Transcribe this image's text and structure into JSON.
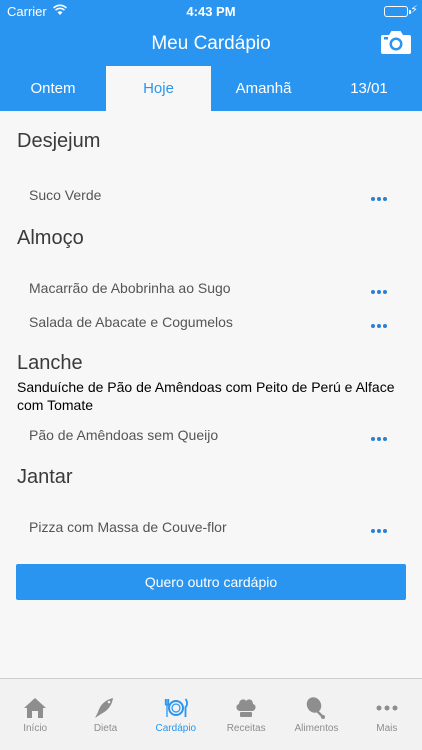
{
  "status_bar": {
    "carrier": "Carrier",
    "time": "4:43 PM"
  },
  "nav": {
    "title": "Meu Cardápio",
    "camera_icon": "camera-icon"
  },
  "tabs": [
    {
      "label": "Ontem"
    },
    {
      "label": "Hoje",
      "active": true
    },
    {
      "label": "Amanhã"
    },
    {
      "label": "13/01"
    }
  ],
  "sections": {
    "desjejum": {
      "title": "Desjejum",
      "items": [
        {
          "label": "Suco Verde"
        }
      ]
    },
    "almoco": {
      "title": "Almoço",
      "items": [
        {
          "label": "Macarrão de Abobrinha ao Sugo"
        },
        {
          "label": "Salada de Abacate e Cogumelos"
        }
      ]
    },
    "lanche": {
      "title": "Lanche",
      "note": "Sanduíche de Pão de Amêndoas com Peito de Perú e Alface com Tomate",
      "items": [
        {
          "label": "Pão de Amêndoas sem Queijo"
        }
      ]
    },
    "jantar": {
      "title": "Jantar",
      "items": [
        {
          "label": "Pizza com Massa de Couve-flor"
        }
      ]
    }
  },
  "cta_label": "Quero outro cardápio",
  "tabbar": [
    {
      "label": "Início",
      "icon": "house-icon"
    },
    {
      "label": "Dieta",
      "icon": "fish-icon"
    },
    {
      "label": "Cardápio",
      "icon": "plate-icon",
      "active": true
    },
    {
      "label": "Receitas",
      "icon": "chef-hat-icon"
    },
    {
      "label": "Alimentos",
      "icon": "drumstick-icon"
    },
    {
      "label": "Mais",
      "icon": "more-icon"
    }
  ],
  "colors": {
    "primary": "#2a95f0",
    "background": "#f7f7f7",
    "tabbar": "#f2f2f2"
  }
}
